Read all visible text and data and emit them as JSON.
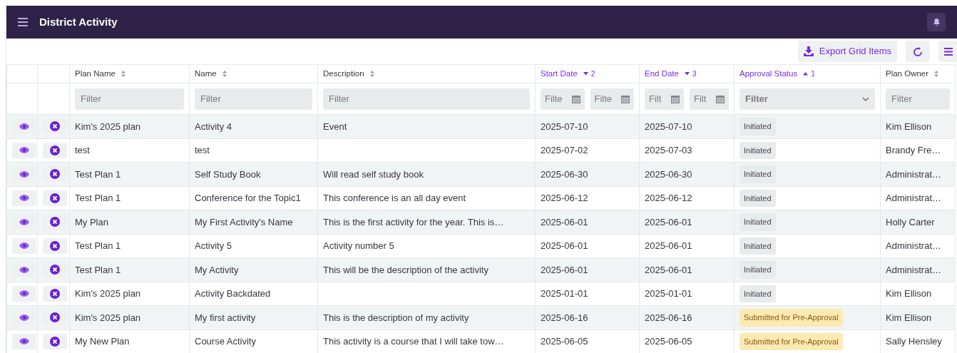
{
  "window": {
    "title": "District Activity"
  },
  "toolbar": {
    "export_label": "Export Grid Items"
  },
  "columns": [
    {
      "kind": "view"
    },
    {
      "kind": "remove"
    },
    {
      "label": "Plan Name",
      "sorted": false,
      "filter": {
        "kind": "text",
        "placeholders": [
          "Filter"
        ]
      }
    },
    {
      "label": "Name",
      "sorted": false,
      "filter": {
        "kind": "text",
        "placeholders": [
          "Filter"
        ]
      }
    },
    {
      "label": "Description",
      "sorted": false,
      "filter": {
        "kind": "text",
        "placeholders": [
          "Filter"
        ]
      }
    },
    {
      "label": "Start Date",
      "sorted": true,
      "descending": true,
      "sort_order": "2",
      "filter": {
        "kind": "date-range",
        "placeholders": [
          "Filte",
          "Filte"
        ]
      }
    },
    {
      "label": "End Date",
      "sorted": true,
      "descending": true,
      "sort_order": "3",
      "filter": {
        "kind": "date-range",
        "placeholders": [
          "Filt",
          "Filt"
        ]
      }
    },
    {
      "label": "Approval Status",
      "sorted": true,
      "descending": false,
      "sort_order": "1",
      "filter": {
        "kind": "select",
        "placeholders": [
          "Filter"
        ]
      }
    },
    {
      "label": "Plan Owner",
      "sorted": false,
      "filter": {
        "kind": "text",
        "placeholders": [
          "Filter"
        ]
      }
    }
  ],
  "rows": [
    {
      "plan_name": "Kim's 2025 plan",
      "name": "Activity 4",
      "description": "Event",
      "start_date": "2025-07-10",
      "end_date": "2025-07-10",
      "status": {
        "label": "Initiated",
        "color": "#e8ebec"
      },
      "plan_owner": "Kim Ellison"
    },
    {
      "plan_name": "test",
      "name": "test",
      "start_date": "2025-07-02",
      "end_date": "2025-07-03",
      "status": {
        "label": "Initiated",
        "color": "#e8ebec"
      },
      "plan_owner": "Brandy Fre…"
    },
    {
      "plan_name": "Test Plan 1",
      "name": "Self Study Book",
      "description": "Will read self study book",
      "start_date": "2025-06-30",
      "end_date": "2025-06-30",
      "status": {
        "label": "Initiated",
        "color": "#e8ebec"
      },
      "plan_owner": "Administrat…"
    },
    {
      "plan_name": "Test Plan 1",
      "name": "Conference for the Topic1",
      "description": "This conference is an all day event",
      "start_date": "2025-06-12",
      "end_date": "2025-06-12",
      "status": {
        "label": "Initiated",
        "color": "#e8ebec"
      },
      "plan_owner": "Administrat…"
    },
    {
      "plan_name": "My Plan",
      "name": "My First Activity's Name",
      "description": "This is the first activity for the year. This is…",
      "start_date": "2025-06-01",
      "end_date": "2025-06-01",
      "status": {
        "label": "Initiated",
        "color": "#e8ebec"
      },
      "plan_owner": "Holly Carter"
    },
    {
      "plan_name": "Test Plan 1",
      "name": "Activity 5",
      "description": "Activity number 5",
      "start_date": "2025-06-01",
      "end_date": "2025-06-01",
      "status": {
        "label": "Initiated",
        "color": "#e8ebec"
      },
      "plan_owner": "Administrat…"
    },
    {
      "plan_name": "Test Plan 1",
      "name": "My Activity",
      "description": "This will be the description of the activity",
      "start_date": "2025-06-01",
      "end_date": "2025-06-01",
      "status": {
        "label": "Initiated",
        "color": "#e8ebec"
      },
      "plan_owner": "Administrat…"
    },
    {
      "plan_name": "Kim's 2025 plan",
      "name": "Activity Backdated",
      "start_date": "2025-01-01",
      "end_date": "2025-01-01",
      "status": {
        "label": "Initiated",
        "color": "#e8ebec"
      },
      "plan_owner": "Kim Ellison"
    },
    {
      "plan_name": "Kim's 2025 plan",
      "name": "My first activity",
      "description": "This is the description of my activity",
      "start_date": "2025-06-16",
      "end_date": "2025-06-16",
      "status": {
        "label": "Submitted for Pre-Approval",
        "color": "#fbeab2"
      },
      "plan_owner": "Kim Ellison"
    },
    {
      "plan_name": "My New Plan",
      "name": "Course Activity",
      "description": "This activity is a course that I will take tow…",
      "start_date": "2025-06-05",
      "end_date": "2025-06-05",
      "status": {
        "label": "Submitted for Pre-Approval",
        "color": "#fbeab2"
      },
      "plan_owner": "Sally Hensley"
    }
  ]
}
